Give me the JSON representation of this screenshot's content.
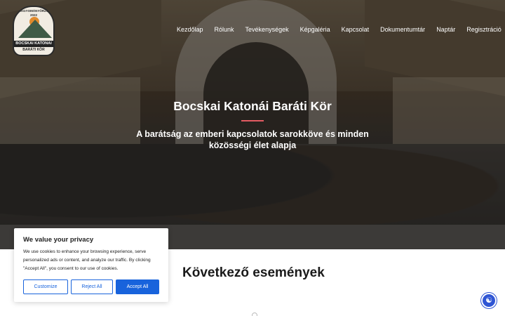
{
  "logo": {
    "ring_text": "HAGYOMÁNYŐRZŐ",
    "year": "2022",
    "name": "BOCSKAI KATONAI",
    "subname": "BARÁTI KÖR"
  },
  "nav": {
    "items": [
      {
        "label": "Kezdőlap"
      },
      {
        "label": "Rólunk"
      },
      {
        "label": "Tevékenységek"
      },
      {
        "label": "Képgaléria"
      },
      {
        "label": "Kapcsolat"
      },
      {
        "label": "Dokumentumtár"
      },
      {
        "label": "Naptár"
      },
      {
        "label": "Regisztráció"
      }
    ]
  },
  "hero": {
    "title": "Bocskai Katonái Baráti Kör",
    "subtitle": "A barátság az emberi kapcsolatok sarokköve és minden közösségi élet alapja",
    "accent_color": "#e35b62"
  },
  "events": {
    "title": "Következő események"
  },
  "cookie": {
    "title": "We value your privacy",
    "text": "We use cookies to enhance your browsing experience, serve personalized ads or content, and analyze our traffic. By clicking \"Accept All\", you consent to our use of cookies.",
    "customize_label": "Customize",
    "reject_label": "Reject All",
    "accept_label": "Accept All",
    "accent_color": "#1863dc"
  },
  "accessibility": {
    "icon": "accessibility-icon"
  }
}
